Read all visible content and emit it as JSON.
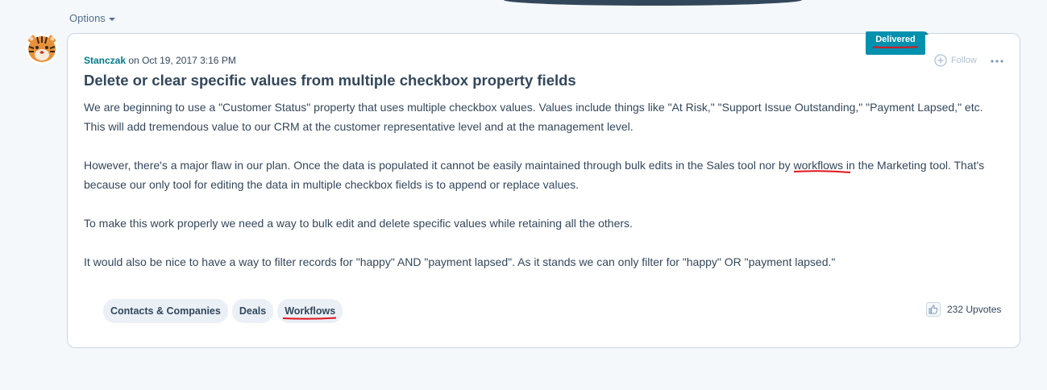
{
  "header": {
    "options_label": "Options"
  },
  "post": {
    "author": "Stanczak",
    "meta_on": "on",
    "date": "Oct 19, 2017 3:16 PM",
    "status_badge": "Delivered",
    "follow_label": "Follow",
    "title": "Delete or clear specific values from multiple checkbox property fields",
    "paragraphs": [
      "We are beginning to use a \"Customer Status\" property that uses multiple checkbox values. Values include things like \"At Risk,\" \"Support Issue Outstanding,\" \"Payment Lapsed,\" etc. This will add tremendous value to our CRM at the customer representative level and at the management level.",
      "However, there's a major flaw in our plan. Once the data is populated it cannot be easily maintained through bulk edits in the Sales tool nor by",
      "workflows",
      "in the Marketing tool. That's because our only tool for editing the data in multiple checkbox fields is to append or replace values.",
      "To make this work properly we need a way to bulk edit and delete specific values while retaining all the others.",
      "It would also be nice to have a way to filter records for \"happy\" AND \"payment lapsed\". As it stands we can only filter for \"happy\" OR \"payment lapsed.\""
    ],
    "tags": [
      "Contacts & Companies",
      "Deals",
      "Workflows"
    ],
    "upvotes": "232 Upvotes"
  },
  "icons": {
    "avatar": "tiger-avatar-icon",
    "follow": "plus-circle-icon",
    "more": "ellipsis-icon",
    "upvote": "thumbs-up-icon",
    "options_caret": "caret-down-icon"
  },
  "colors": {
    "accent": "#0091ae",
    "author": "#007a8c",
    "text": "#33475b",
    "annotation": "#e0141e",
    "tag_bg": "#eaf0f6",
    "page_bg": "#f5f8fa"
  }
}
